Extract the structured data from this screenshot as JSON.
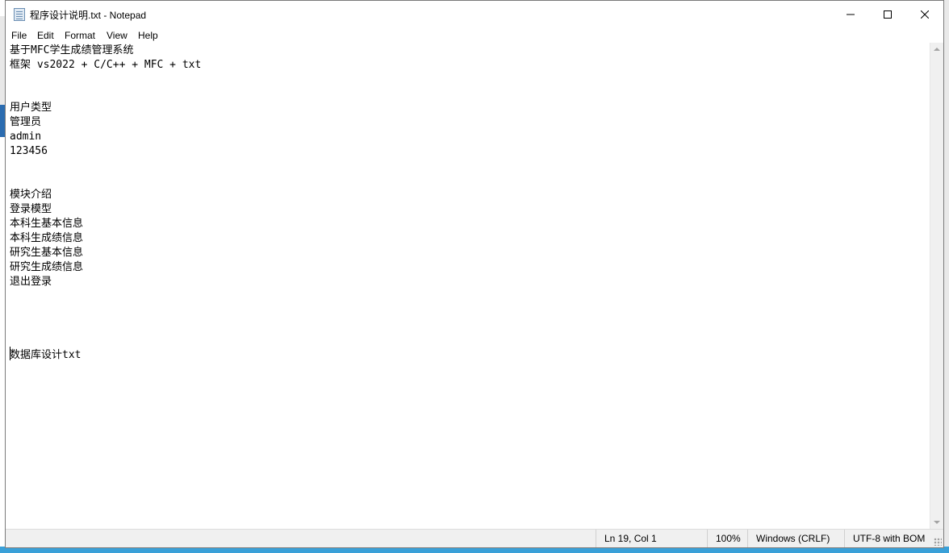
{
  "window": {
    "title": "程序设计说明.txt - Notepad",
    "icons": {
      "app": "notepad-icon",
      "minimize": "minimize-icon",
      "maximize": "maximize-icon",
      "close": "close-icon"
    }
  },
  "menu": {
    "file": "File",
    "edit": "Edit",
    "format": "Format",
    "view": "View",
    "help": "Help"
  },
  "editor": {
    "lines": [
      "基于MFC学生成绩管理系统",
      "框架 vs2022 + C/C++ + MFC + txt",
      "",
      "",
      "用户类型",
      "管理员",
      "admin",
      "123456",
      "",
      "",
      "模块介绍",
      "登录模型",
      "本科生基本信息",
      "本科生成绩信息",
      "研究生基本信息",
      "研究生成绩信息",
      "退出登录",
      "",
      "",
      "",
      "",
      "数据库设计txt"
    ]
  },
  "status": {
    "position": "Ln 19, Col 1",
    "zoom": "100%",
    "line_ending": "Windows (CRLF)",
    "encoding": "UTF-8 with BOM"
  }
}
